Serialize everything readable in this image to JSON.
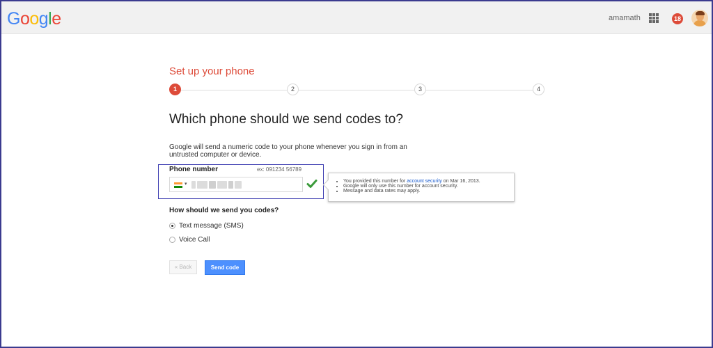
{
  "header": {
    "logo_letters": [
      "G",
      "o",
      "o",
      "g",
      "l",
      "e"
    ],
    "logo_colors": [
      "#4285f4",
      "#ea4335",
      "#fbbc05",
      "#4285f4",
      "#34a853",
      "#ea4335"
    ],
    "username": "amamath",
    "apps_icon": "apps-grid-icon",
    "notification_count": "18",
    "avatar_icon": "user-avatar"
  },
  "setup": {
    "title": "Set up your phone",
    "steps": [
      "1",
      "2",
      "3",
      "4"
    ],
    "active_step": 1
  },
  "main": {
    "heading": "Which phone should we send codes to?",
    "description": "Google will send a numeric code to your phone whenever you sign in from an untrusted computer or device."
  },
  "phone": {
    "label": "Phone number",
    "example": "ex: 091234 56789",
    "country": "India",
    "country_caret": "▾",
    "value": "",
    "valid_icon": "checkmark-icon",
    "valid_color": "#3a9a3a"
  },
  "tooltip": {
    "line1_prefix": "You provided this number for ",
    "line1_link": "account security",
    "line1_suffix": " on Mar 16, 2013.",
    "line2": "Google will only use this number for account security.",
    "line3": "Message and data rates may apply."
  },
  "delivery": {
    "question": "How should we send you codes?",
    "options": [
      {
        "label": "Text message (SMS)",
        "selected": true
      },
      {
        "label": "Voice Call",
        "selected": false
      }
    ]
  },
  "buttons": {
    "back": "« Back",
    "send": "Send code"
  }
}
